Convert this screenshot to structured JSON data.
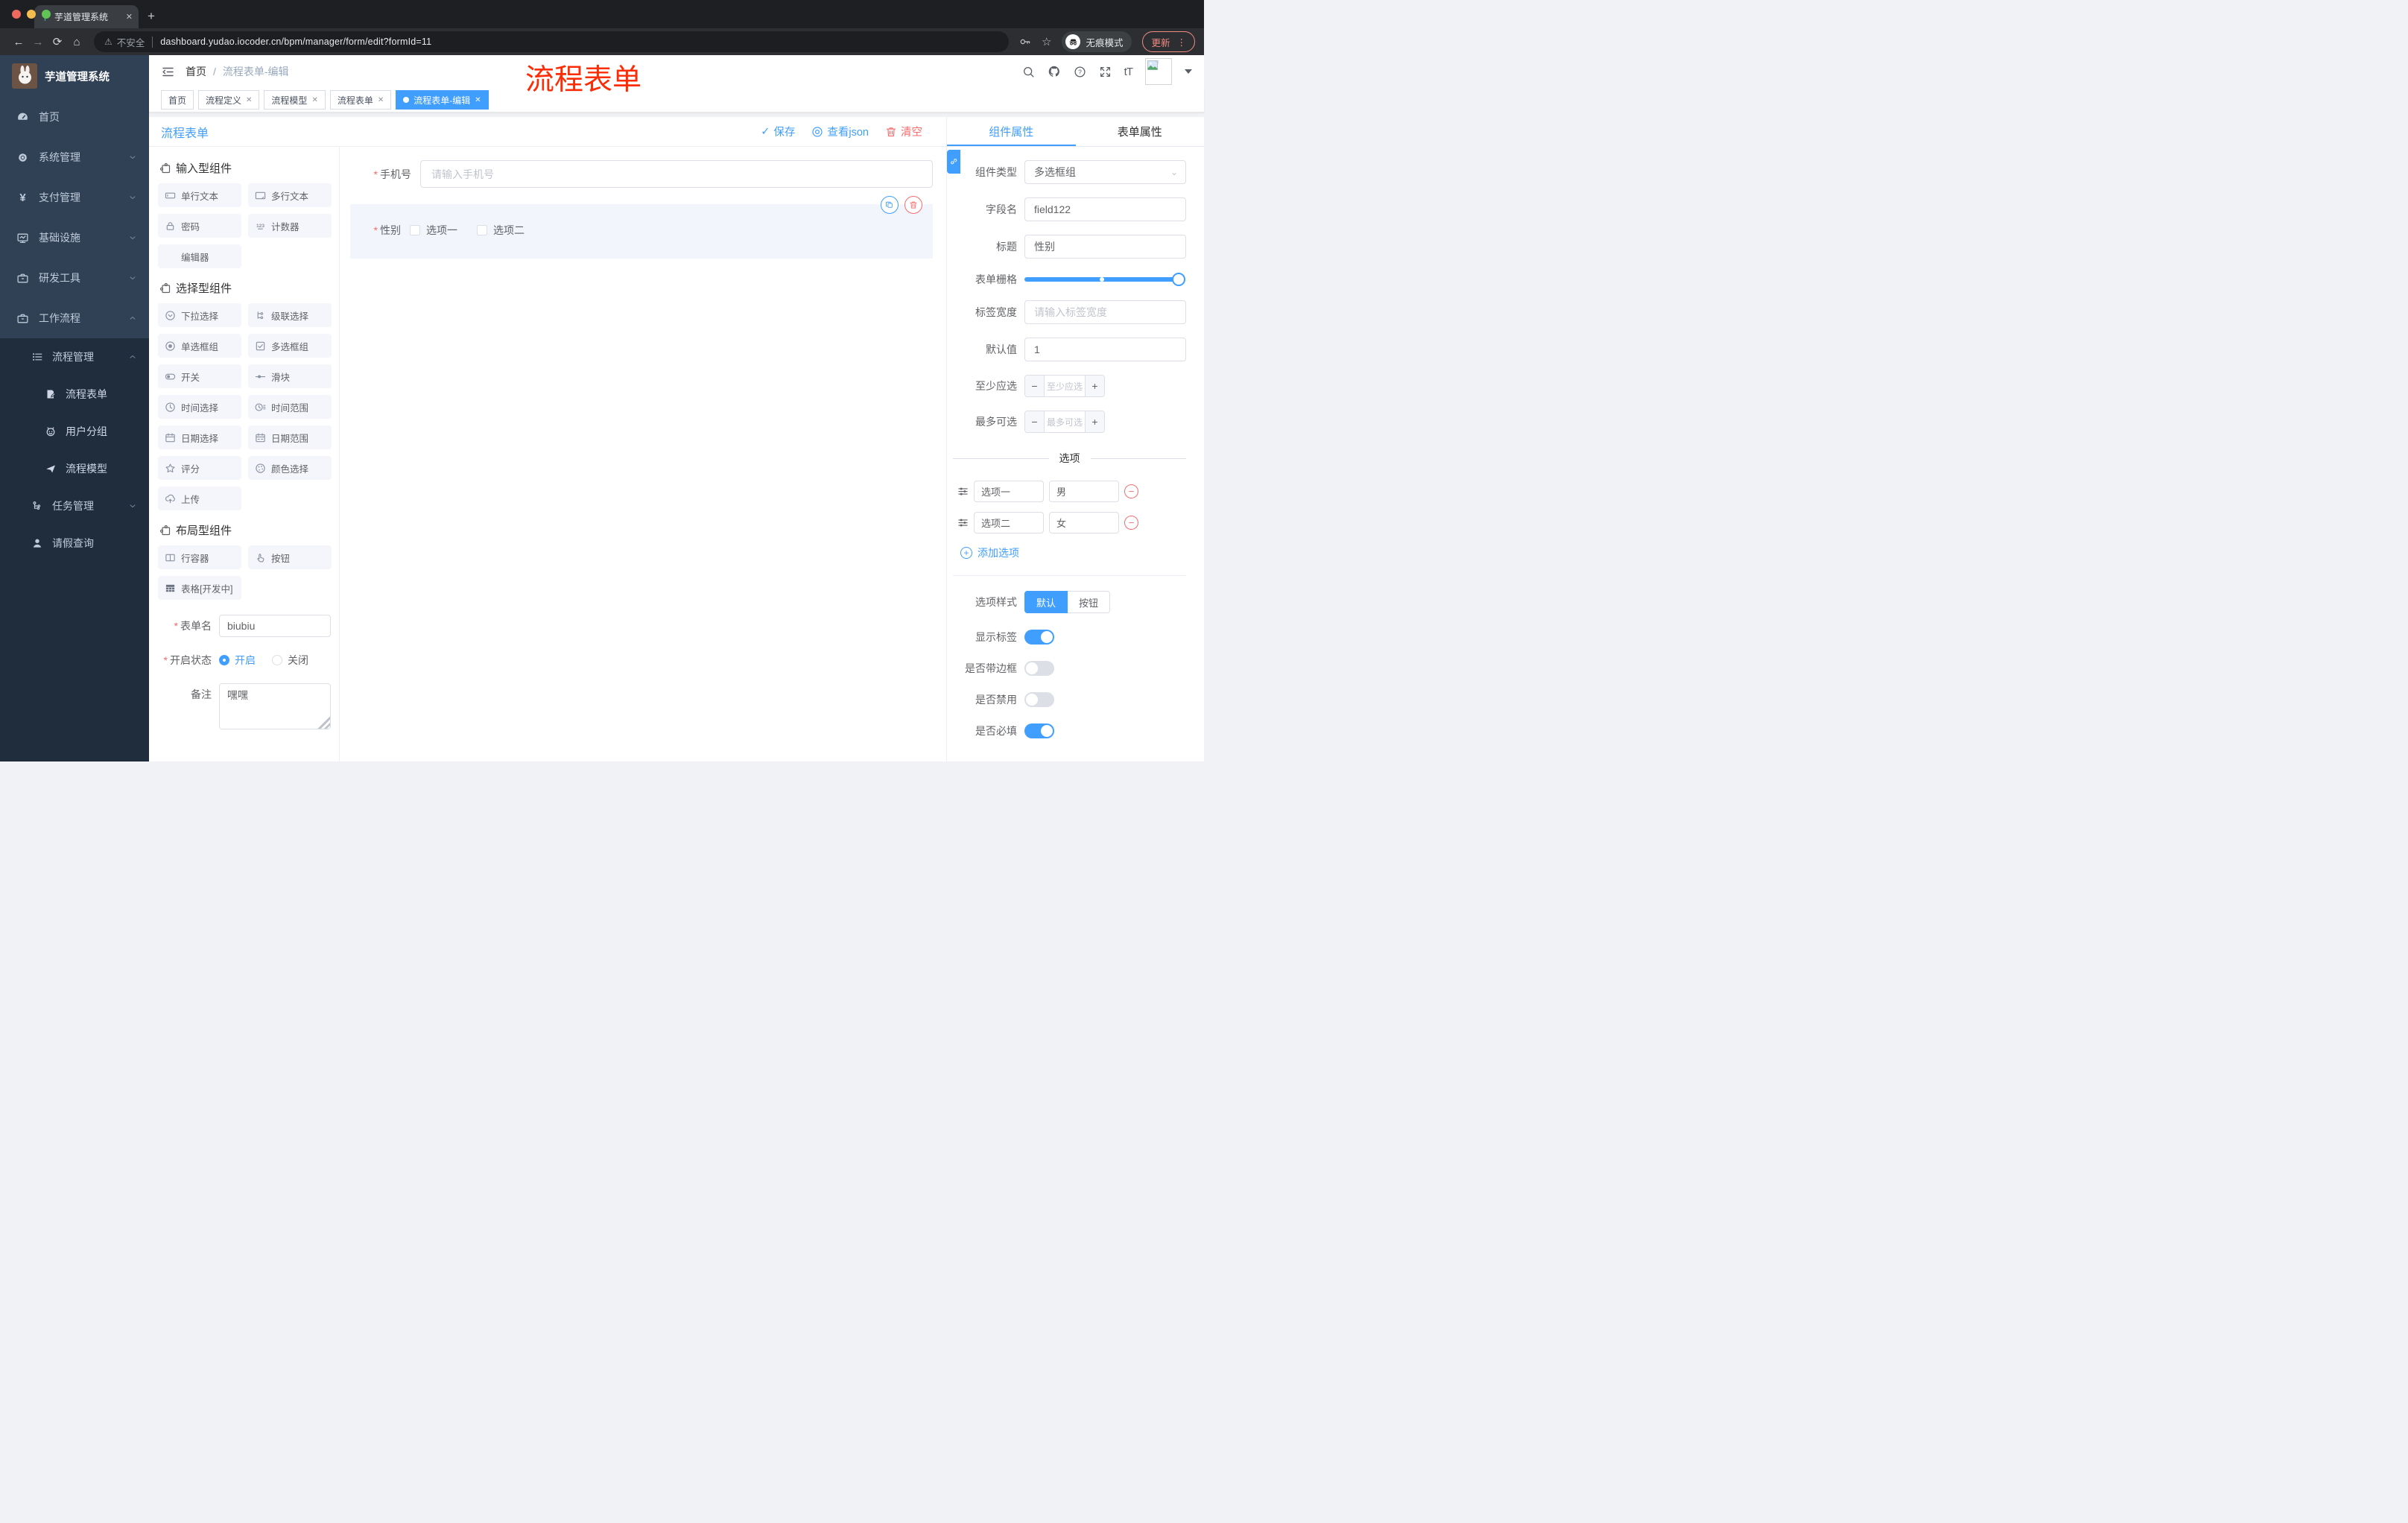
{
  "colors": {
    "primary": "#409eff",
    "danger": "#f56c6c",
    "annotation_red": "#fb2c06",
    "sidebar_bg": "#304156",
    "submenu_bg": "#1f2d3d"
  },
  "browser": {
    "tab_title": "芋道管理系统",
    "close_glyph": "✕",
    "newtab_glyph": "+",
    "back": "←",
    "forward": "→",
    "reload": "⟳",
    "home": "⌂",
    "warning_glyph": "⚠",
    "security_label": "不安全",
    "url": "dashboard.yudao.iocoder.cn/bpm/manager/form/edit?formId=11",
    "star_glyph": "☆",
    "incognito_label": "无痕模式",
    "update_label": "更新",
    "more_glyph": "⋮"
  },
  "annotation": "流程表单",
  "sidebar": {
    "brand": "芋道管理系统",
    "top": [
      {
        "label": "首页"
      },
      {
        "label": "系统管理"
      },
      {
        "label": "支付管理"
      },
      {
        "label": "基础设施"
      },
      {
        "label": "研发工具"
      },
      {
        "label": "工作流程"
      }
    ],
    "process_group": "流程管理",
    "process_children": [
      "流程表单",
      "用户分组",
      "流程模型"
    ],
    "task_group": "任务管理",
    "leave_item": "请假查询"
  },
  "header": {
    "breadcrumb_home": "首页",
    "breadcrumb_sep": "/",
    "breadcrumb_current": "流程表单-编辑",
    "font_icon_glyph": "tT"
  },
  "tags": [
    {
      "label": "首页"
    },
    {
      "label": "流程定义"
    },
    {
      "label": "流程模型"
    },
    {
      "label": "流程表单"
    },
    {
      "label": "流程表单-编辑"
    }
  ],
  "toolbar": {
    "title": "流程表单",
    "check_glyph": "✓",
    "save": "保存",
    "view_json": "查看json",
    "clear": "清空"
  },
  "palette": {
    "sections": [
      {
        "title": "输入型组件",
        "items": [
          {
            "label": "单行文本"
          },
          {
            "label": "多行文本"
          },
          {
            "label": "密码"
          },
          {
            "label": "计数器"
          },
          {
            "label": "编辑器"
          }
        ]
      },
      {
        "title": "选择型组件",
        "items": [
          {
            "label": "下拉选择"
          },
          {
            "label": "级联选择"
          },
          {
            "label": "单选框组"
          },
          {
            "label": "多选框组"
          },
          {
            "label": "开关"
          },
          {
            "label": "滑块"
          },
          {
            "label": "时间选择"
          },
          {
            "label": "时间范围"
          },
          {
            "label": "日期选择"
          },
          {
            "label": "日期范围"
          },
          {
            "label": "评分"
          },
          {
            "label": "颜色选择"
          },
          {
            "label": "上传"
          }
        ]
      },
      {
        "title": "布局型组件",
        "items": [
          {
            "label": "行容器"
          },
          {
            "label": "按钮"
          },
          {
            "label": "表格[开发中]"
          }
        ]
      }
    ]
  },
  "form_meta": {
    "name_label": "表单名",
    "name_value": "biubiu",
    "status_label": "开启状态",
    "status_on": "开启",
    "status_off": "关闭",
    "remark_label": "备注",
    "remark_value": "嘿嘿"
  },
  "canvas": {
    "phone_label": "手机号",
    "phone_placeholder": "请输入手机号",
    "gender_label": "性别",
    "gender_options": [
      "选项一",
      "选项二"
    ]
  },
  "props": {
    "tab_component": "组件属性",
    "tab_form": "表单属性",
    "type_label": "组件类型",
    "type_value": "多选框组",
    "field_label": "字段名",
    "field_value": "field122",
    "title_label": "标题",
    "title_value": "性别",
    "grid_label": "表单栅格",
    "label_width_label": "标签宽度",
    "label_width_placeholder": "请输入标签宽度",
    "default_label": "默认值",
    "default_value": "1",
    "min_label": "至少应选",
    "min_placeholder": "至少应选",
    "max_label": "最多可选",
    "max_placeholder": "最多可选",
    "minus_glyph": "−",
    "plus_glyph": "+",
    "options_title": "选项",
    "options": [
      {
        "label": "选项一",
        "value": "男"
      },
      {
        "label": "选项二",
        "value": "女"
      }
    ],
    "add_option": "添加选项",
    "style_label": "选项样式",
    "style_default": "默认",
    "style_button": "按钮",
    "toggle_show_label": "显示标签",
    "toggle_border_label": "是否带边框",
    "toggle_disabled_label": "是否禁用",
    "toggle_required_label": "是否必填"
  }
}
